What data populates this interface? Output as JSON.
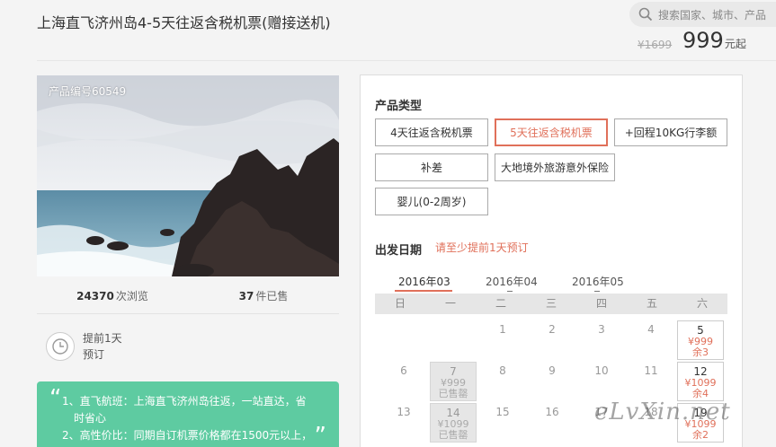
{
  "header": {
    "title": "上海直飞济州岛4-5天往返含税机票(赠接送机)",
    "search_placeholder": "搜索国家、城市、产品",
    "old_price": "¥1699",
    "price": "999",
    "price_unit": "元起"
  },
  "hero": {
    "product_code": "产品编号60549"
  },
  "stats": {
    "views_count": "24370",
    "views_label": "次浏览",
    "sold_count": "37",
    "sold_label": "件已售"
  },
  "advance": {
    "line1": "提前1天",
    "line2": "预订"
  },
  "note": {
    "line1": "1、直飞航班：上海直飞济州岛往返，一站直达，省",
    "line2": "时省心",
    "line3": "2、高性价比：同期自订机票价格都在1500元以上，",
    "quote_open": "“",
    "quote_close": "”"
  },
  "product_type": {
    "title": "产品类型",
    "options": [
      {
        "label": "4天往返含税机票"
      },
      {
        "label": "5天往返含税机票"
      },
      {
        "label": "+回程10KG行李额"
      },
      {
        "label": "补差"
      },
      {
        "label": "大地境外旅游意外保险"
      },
      {
        "label": "婴儿(0-2周岁)"
      }
    ],
    "selected": "5天往返含税机票"
  },
  "departure": {
    "title": "出发日期",
    "hint": "请至少提前1天预订",
    "months": [
      "2016年03",
      "2016年04",
      "2016年05"
    ],
    "active_month": "2016年03",
    "weekdays": [
      "日",
      "一",
      "二",
      "三",
      "四",
      "五",
      "六"
    ],
    "rows": [
      [
        {
          "d": ""
        },
        {
          "d": ""
        },
        {
          "d": "1"
        },
        {
          "d": "2"
        },
        {
          "d": "3"
        },
        {
          "d": "4"
        },
        {
          "d": "5",
          "price": "¥999",
          "stock": "余3",
          "state": "avail"
        }
      ],
      [
        {
          "d": "6"
        },
        {
          "d": "7",
          "price": "¥999",
          "stock": "已售罄",
          "state": "past"
        },
        {
          "d": "8"
        },
        {
          "d": "9"
        },
        {
          "d": "10"
        },
        {
          "d": "11"
        },
        {
          "d": "12",
          "price": "¥1099",
          "stock": "余4",
          "state": "avail"
        }
      ],
      [
        {
          "d": "13"
        },
        {
          "d": "14",
          "price": "¥1099",
          "stock": "已售罄",
          "state": "past"
        },
        {
          "d": "15"
        },
        {
          "d": "16"
        },
        {
          "d": "17"
        },
        {
          "d": "18"
        },
        {
          "d": "19",
          "price": "¥1099",
          "stock": "余2",
          "state": "avail"
        }
      ]
    ]
  },
  "watermark": "eLvXin.net",
  "colors": {
    "accent": "#e0705a",
    "note_bg": "#5ecba1"
  }
}
